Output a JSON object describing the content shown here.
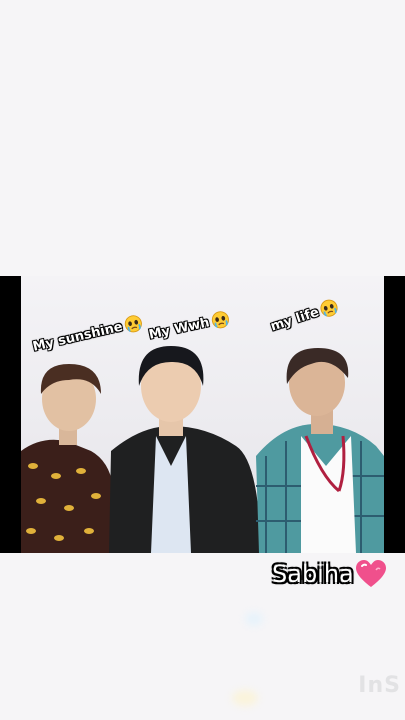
{
  "captions": {
    "left": "My sunshine",
    "middle": "My Wwh",
    "right": "my life"
  },
  "name_tag": "Sabiha",
  "watermark": "InS",
  "colors": {
    "background": "#f6f5f7",
    "letterbox": "#000000",
    "caption_text": "#ffffff",
    "caption_outline": "#000000",
    "heart": "#f0508c"
  },
  "icons": {
    "caption_emoji": "crying-face-icon",
    "name_emoji": "pink-heart-icon"
  }
}
